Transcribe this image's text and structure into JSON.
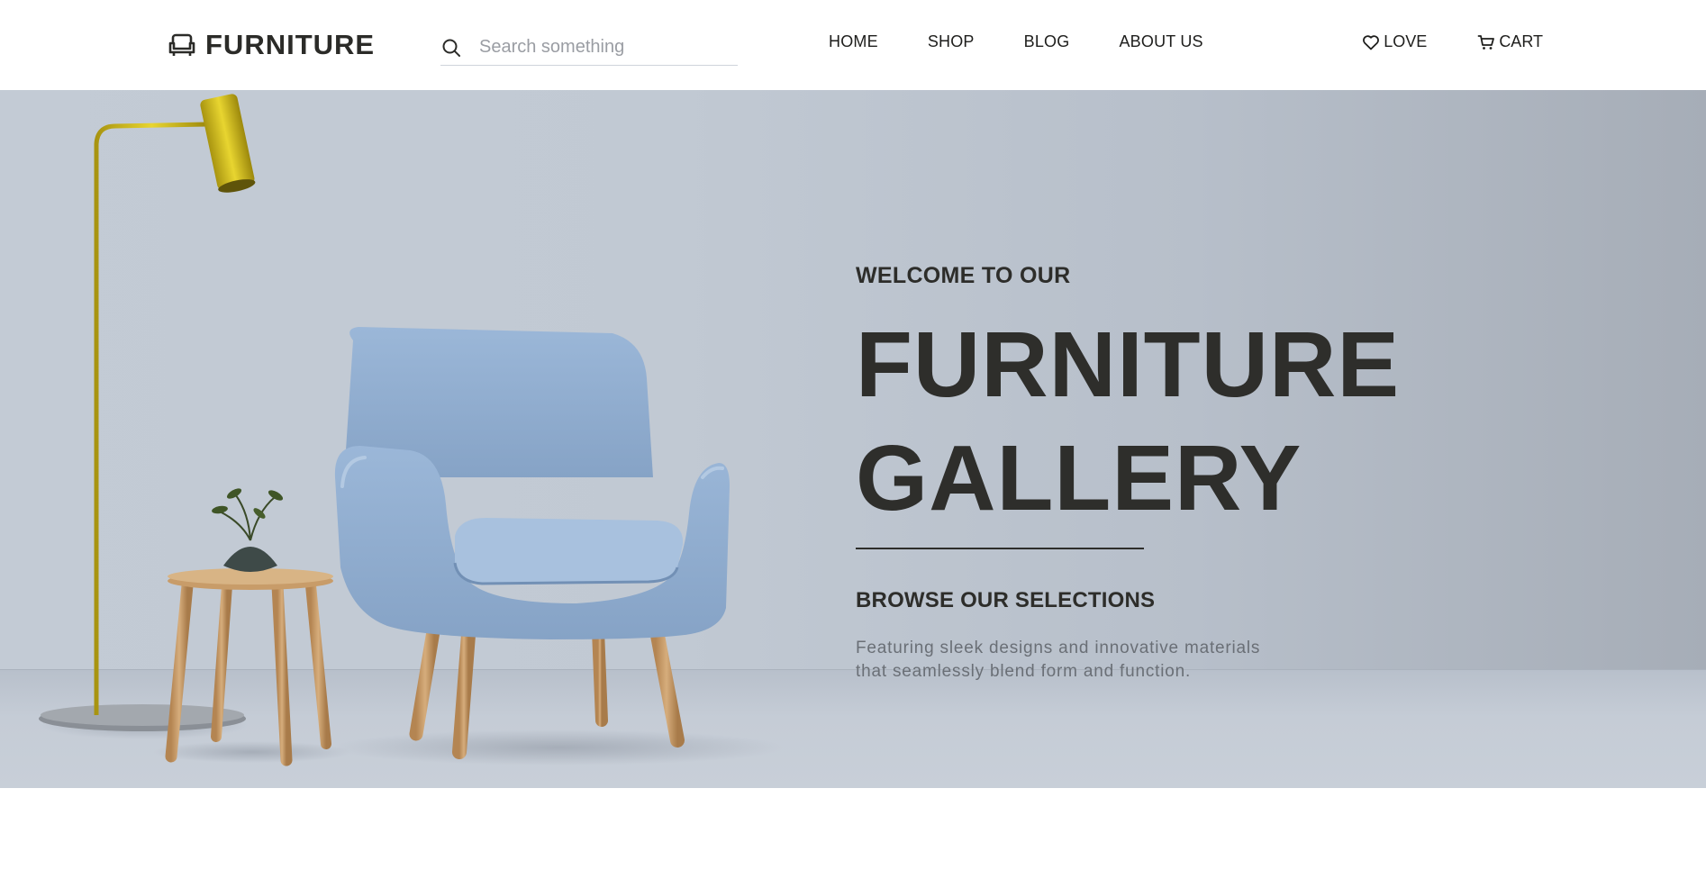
{
  "header": {
    "brand": {
      "name": "FURNITURE",
      "icon": "sofa-icon"
    },
    "search": {
      "placeholder": "Search something",
      "value": "",
      "icon": "search-icon"
    },
    "nav": [
      {
        "label": "HOME"
      },
      {
        "label": "SHOP"
      },
      {
        "label": "BLOG"
      },
      {
        "label": "ABOUT US"
      }
    ],
    "actions": [
      {
        "label": "LOVE",
        "icon": "heart-icon"
      },
      {
        "label": "CART",
        "icon": "cart-icon"
      }
    ]
  },
  "hero": {
    "eyebrow": "WELCOME TO OUR",
    "headline_line1": "FURNITURE",
    "headline_line2": "GALLERY",
    "subhead": "BROWSE OUR SELECTIONS",
    "description_line1": "Featuring sleek designs and innovative materials",
    "description_line2": "that seamlessly blend form and function."
  },
  "colors": {
    "text_dark": "#2b2b28",
    "hero_background": "#c1c9d3",
    "chair_blue": "#94b1d3",
    "lamp_gold": "#c9b51a",
    "wood": "#c69b6a"
  }
}
